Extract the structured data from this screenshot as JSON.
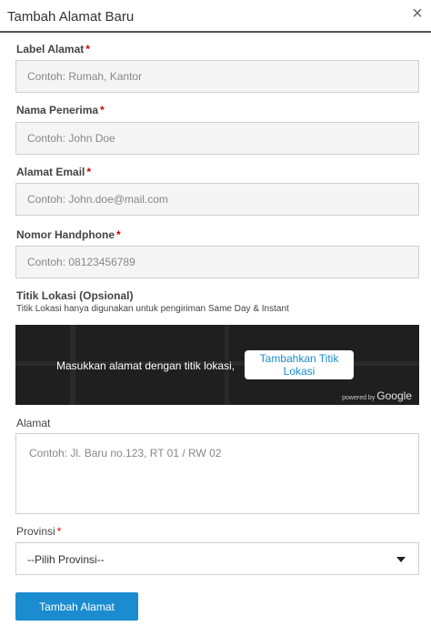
{
  "header": {
    "title": "Tambah Alamat Baru",
    "close_icon": "×"
  },
  "fields": {
    "label": {
      "label": "Label Alamat",
      "required": "*",
      "placeholder": "Contoh: Rumah, Kantor"
    },
    "recipient": {
      "label": "Nama Penerima",
      "required": "*",
      "placeholder": "Contoh: John Doe"
    },
    "email": {
      "label": "Alamat Email",
      "required": "*",
      "placeholder": "Contoh: John.doe@mail.com"
    },
    "phone": {
      "label": "Nomor Handphone",
      "required": "*",
      "placeholder": "Contoh: 08123456789"
    },
    "location": {
      "label": "Titik Lokasi (Opsional)",
      "hint": "Titik Lokasi hanya digunakan untuk pengiriman Same Day & Instant",
      "map_text": "Masukkan alamat dengan titik lokasi,",
      "map_button": "Tambahkan Titik Lokasi",
      "powered_by": "powered by",
      "google": "Google"
    },
    "address": {
      "label": "Alamat",
      "placeholder": "Contoh: Jl. Baru no.123, RT 01 / RW 02"
    },
    "province": {
      "label": "Provinsi",
      "required": "*",
      "selected": "--Pilih Provinsi--"
    }
  },
  "submit_label": "Tambah Alamat"
}
